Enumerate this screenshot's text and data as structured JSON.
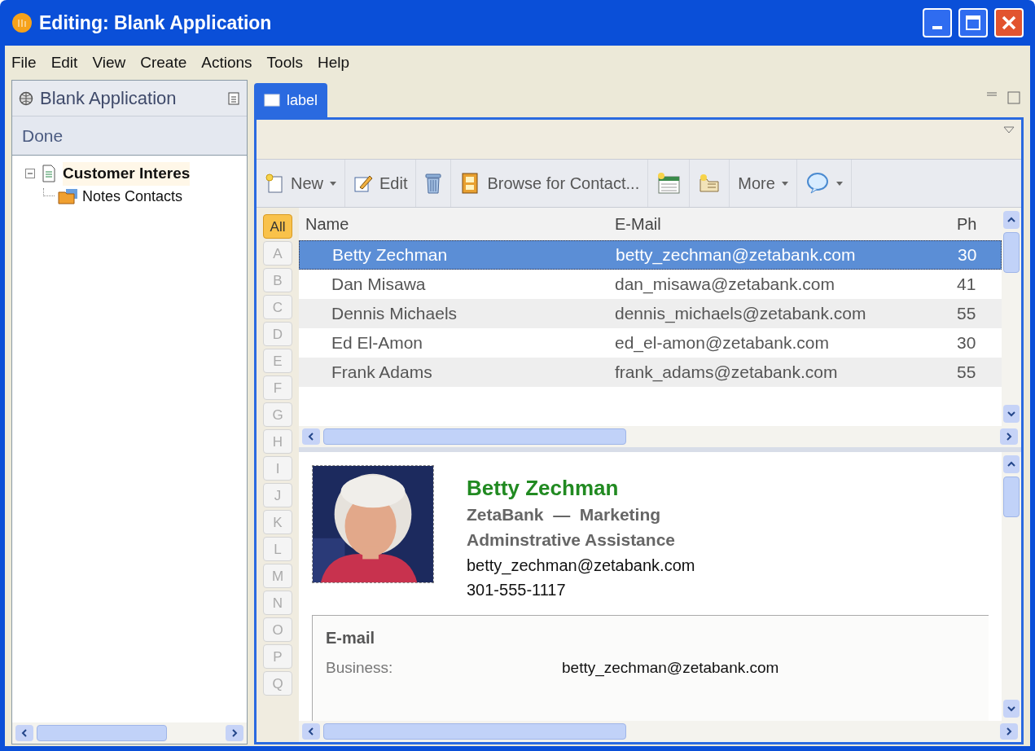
{
  "window": {
    "title": "Editing: Blank Application"
  },
  "menu": [
    "File",
    "Edit",
    "View",
    "Create",
    "Actions",
    "Tools",
    "Help"
  ],
  "left_panel": {
    "title": "Blank Application",
    "action": "Done",
    "tree": [
      {
        "label": "Customer Interes",
        "expanded": true,
        "children": [
          {
            "label": "Notes Contacts"
          }
        ]
      }
    ]
  },
  "tabs": [
    {
      "label": "label",
      "selected": true
    }
  ],
  "toolbar": [
    {
      "kind": "new",
      "label": "New",
      "dropdown": true
    },
    {
      "kind": "edit",
      "label": "Edit",
      "dropdown": false
    },
    {
      "kind": "delete",
      "dropdown": false
    },
    {
      "kind": "browse",
      "label": "Browse for Contact...",
      "dropdown": false
    },
    {
      "kind": "calendar",
      "dropdown": false
    },
    {
      "kind": "note",
      "dropdown": false
    },
    {
      "kind": "more",
      "label": "More",
      "dropdown": true
    },
    {
      "kind": "chat",
      "dropdown": true
    }
  ],
  "alphabet": [
    {
      "label": "All",
      "selected": true
    },
    {
      "label": "A",
      "selected": false
    },
    {
      "label": "B",
      "selected": false
    },
    {
      "label": "C",
      "selected": false
    },
    {
      "label": "D",
      "selected": false
    },
    {
      "label": "E",
      "selected": false
    },
    {
      "label": "F",
      "selected": false
    },
    {
      "label": "G",
      "selected": false
    },
    {
      "label": "H",
      "selected": false
    },
    {
      "label": "I",
      "selected": false
    },
    {
      "label": "J",
      "selected": false
    },
    {
      "label": "K",
      "selected": false
    },
    {
      "label": "L",
      "selected": false
    },
    {
      "label": "M",
      "selected": false
    },
    {
      "label": "N",
      "selected": false
    },
    {
      "label": "O",
      "selected": false
    },
    {
      "label": "P",
      "selected": false
    },
    {
      "label": "Q",
      "selected": false
    }
  ],
  "table": {
    "columns": [
      "Name",
      "E-Mail",
      "Ph"
    ],
    "rows": [
      {
        "cells": [
          "Betty Zechman",
          "betty_zechman@zetabank.com",
          "30"
        ],
        "selected": true
      },
      {
        "cells": [
          "Dan Misawa",
          "dan_misawa@zetabank.com",
          "41"
        ],
        "selected": false
      },
      {
        "cells": [
          "Dennis Michaels",
          "dennis_michaels@zetabank.com",
          "55"
        ],
        "selected": false
      },
      {
        "cells": [
          "Ed El-Amon",
          "ed_el-amon@zetabank.com",
          "30"
        ],
        "selected": false
      },
      {
        "cells": [
          "Frank Adams",
          "frank_adams@zetabank.com",
          "55"
        ],
        "selected": false
      }
    ]
  },
  "detail": {
    "name": "Betty Zechman",
    "company": "ZetaBank  —  Marketing",
    "job_title": "Adminstrative Assistance",
    "email": "betty_zechman@zetabank.com",
    "phone": "301-555-1117",
    "section": {
      "title": "E-mail",
      "rows": [
        {
          "label": "Business:",
          "value": "betty_zechman@zetabank.com"
        }
      ]
    }
  }
}
